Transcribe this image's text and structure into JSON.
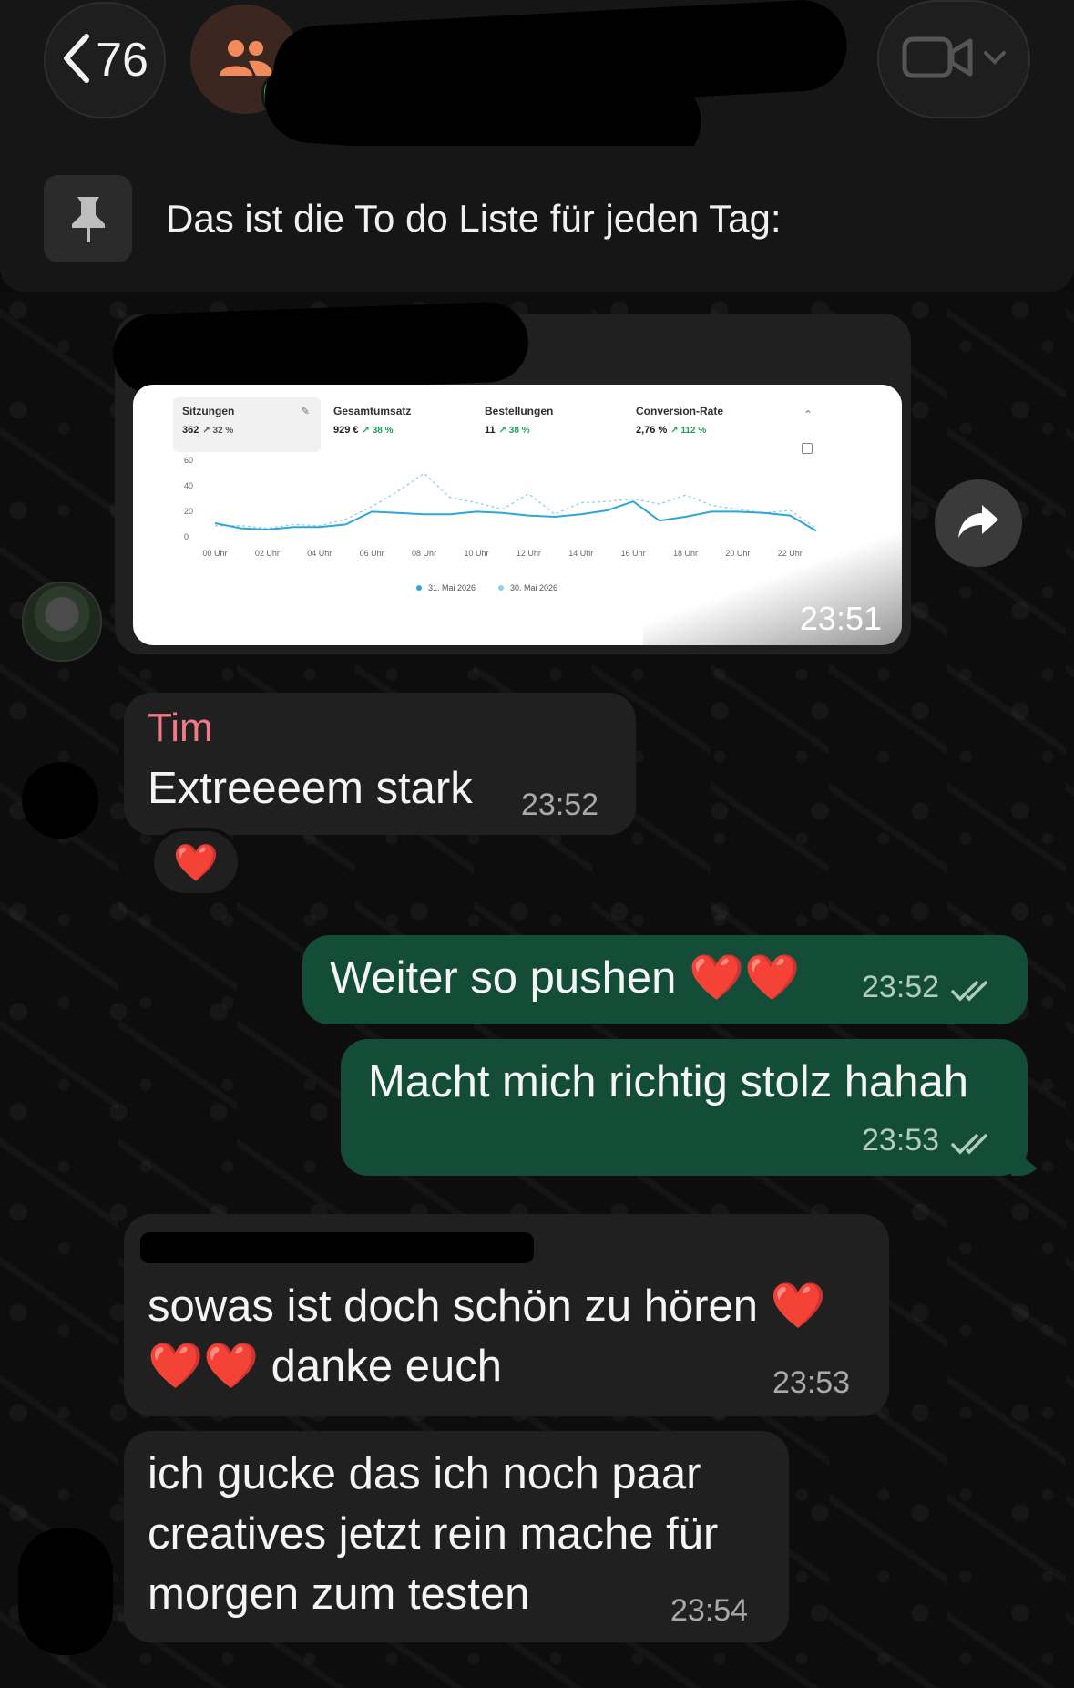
{
  "header": {
    "back_count": "76"
  },
  "pinned": {
    "text": "Das ist die To do Liste für jeden Tag:"
  },
  "messages": [
    {
      "time": "23:51",
      "screenshot": {
        "kpis": [
          {
            "label": "Sitzungen",
            "value": "362",
            "change": "↗ 32 %"
          },
          {
            "label": "Gesamtumsatz",
            "value": "929 €",
            "change": "↗ 38 %"
          },
          {
            "label": "Bestellungen",
            "value": "11",
            "change": "↗ 38 %"
          },
          {
            "label": "Conversion-Rate",
            "value": "2,76 %",
            "change": "↗ 112 %"
          }
        ]
      }
    },
    {
      "sender": "Tim",
      "text": "Extreeeem stark",
      "time": "23:52",
      "reaction": "❤️"
    },
    {
      "text": "Weiter so pushen ❤️❤️",
      "time": "23:52"
    },
    {
      "text": "Macht mich richtig stolz hahah",
      "time": "23:53"
    },
    {
      "line1": "sowas ist doch schön zu hören ❤️",
      "line2": "❤️❤️ danke euch",
      "time": "23:53"
    },
    {
      "line1": "ich gucke das ich noch paar",
      "line2": "creatives jetzt rein mache für",
      "line3": "morgen zum testen",
      "time": "23:54"
    }
  ],
  "chart_data": {
    "type": "line",
    "x": [
      "00 Uhr",
      "01",
      "02 Uhr",
      "03",
      "04 Uhr",
      "05",
      "06 Uhr",
      "07",
      "08 Uhr",
      "09",
      "10 Uhr",
      "11",
      "12 Uhr",
      "13",
      "14 Uhr",
      "15",
      "16 Uhr",
      "17",
      "18 Uhr",
      "19",
      "20 Uhr",
      "21",
      "22 Uhr",
      "23"
    ],
    "tick_labels": [
      "00 Uhr",
      "02 Uhr",
      "04 Uhr",
      "06 Uhr",
      "08 Uhr",
      "10 Uhr",
      "12 Uhr",
      "14 Uhr",
      "16 Uhr",
      "18 Uhr",
      "20 Uhr",
      "22 Uhr"
    ],
    "series": [
      {
        "name": "31. Mai 2026",
        "style": "solid",
        "color": "#2ea7d8",
        "values": [
          10,
          6,
          5,
          7,
          7,
          9,
          19,
          18,
          17,
          17,
          19,
          18,
          16,
          15,
          17,
          20,
          27,
          12,
          15,
          19,
          19,
          18,
          16,
          4
        ]
      },
      {
        "name": "30. Mai 2026",
        "style": "dashed",
        "color": "#8fd0e8",
        "values": [
          8,
          8,
          6,
          9,
          8,
          13,
          23,
          35,
          49,
          30,
          26,
          21,
          33,
          17,
          26,
          27,
          29,
          25,
          32,
          24,
          21,
          18,
          20,
          6
        ]
      }
    ],
    "ylim": [
      0,
      60
    ],
    "yticks": [
      0,
      20,
      40,
      60
    ],
    "legend": "bottom",
    "grid": false
  }
}
